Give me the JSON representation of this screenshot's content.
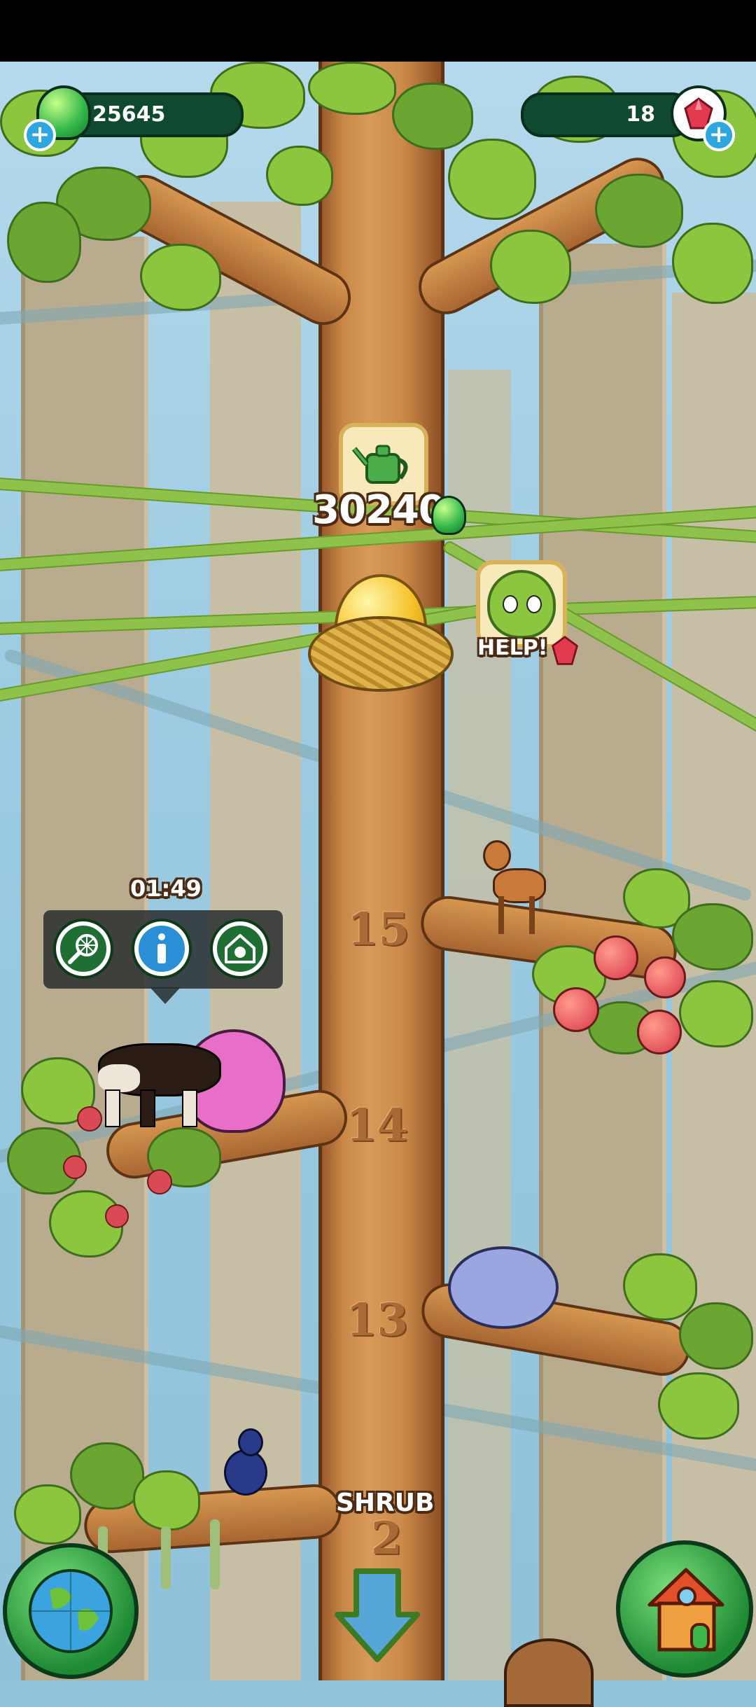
{
  "hud": {
    "gems_green_count": "25645",
    "gems_red_count": "18"
  },
  "task": {
    "cost_value": "30240",
    "help_label": "HELP!"
  },
  "popup": {
    "timer": "01:49"
  },
  "levels": {
    "l15": "15",
    "l14": "14",
    "l13": "13",
    "l12": "2"
  },
  "zone_label": "SHRUB",
  "colors": {
    "accent_green": "#2bb24c",
    "counter_bg": "#0f4a30",
    "trunk_brown": "#c98847",
    "gem_red": "#e23a4e"
  },
  "icons": {
    "net": "net-icon",
    "info": "info-icon",
    "home": "home-icon",
    "watering_can": "watering-can-icon",
    "globe": "globe-icon",
    "house": "house-icon",
    "arrow_down": "arrow-down-icon"
  }
}
